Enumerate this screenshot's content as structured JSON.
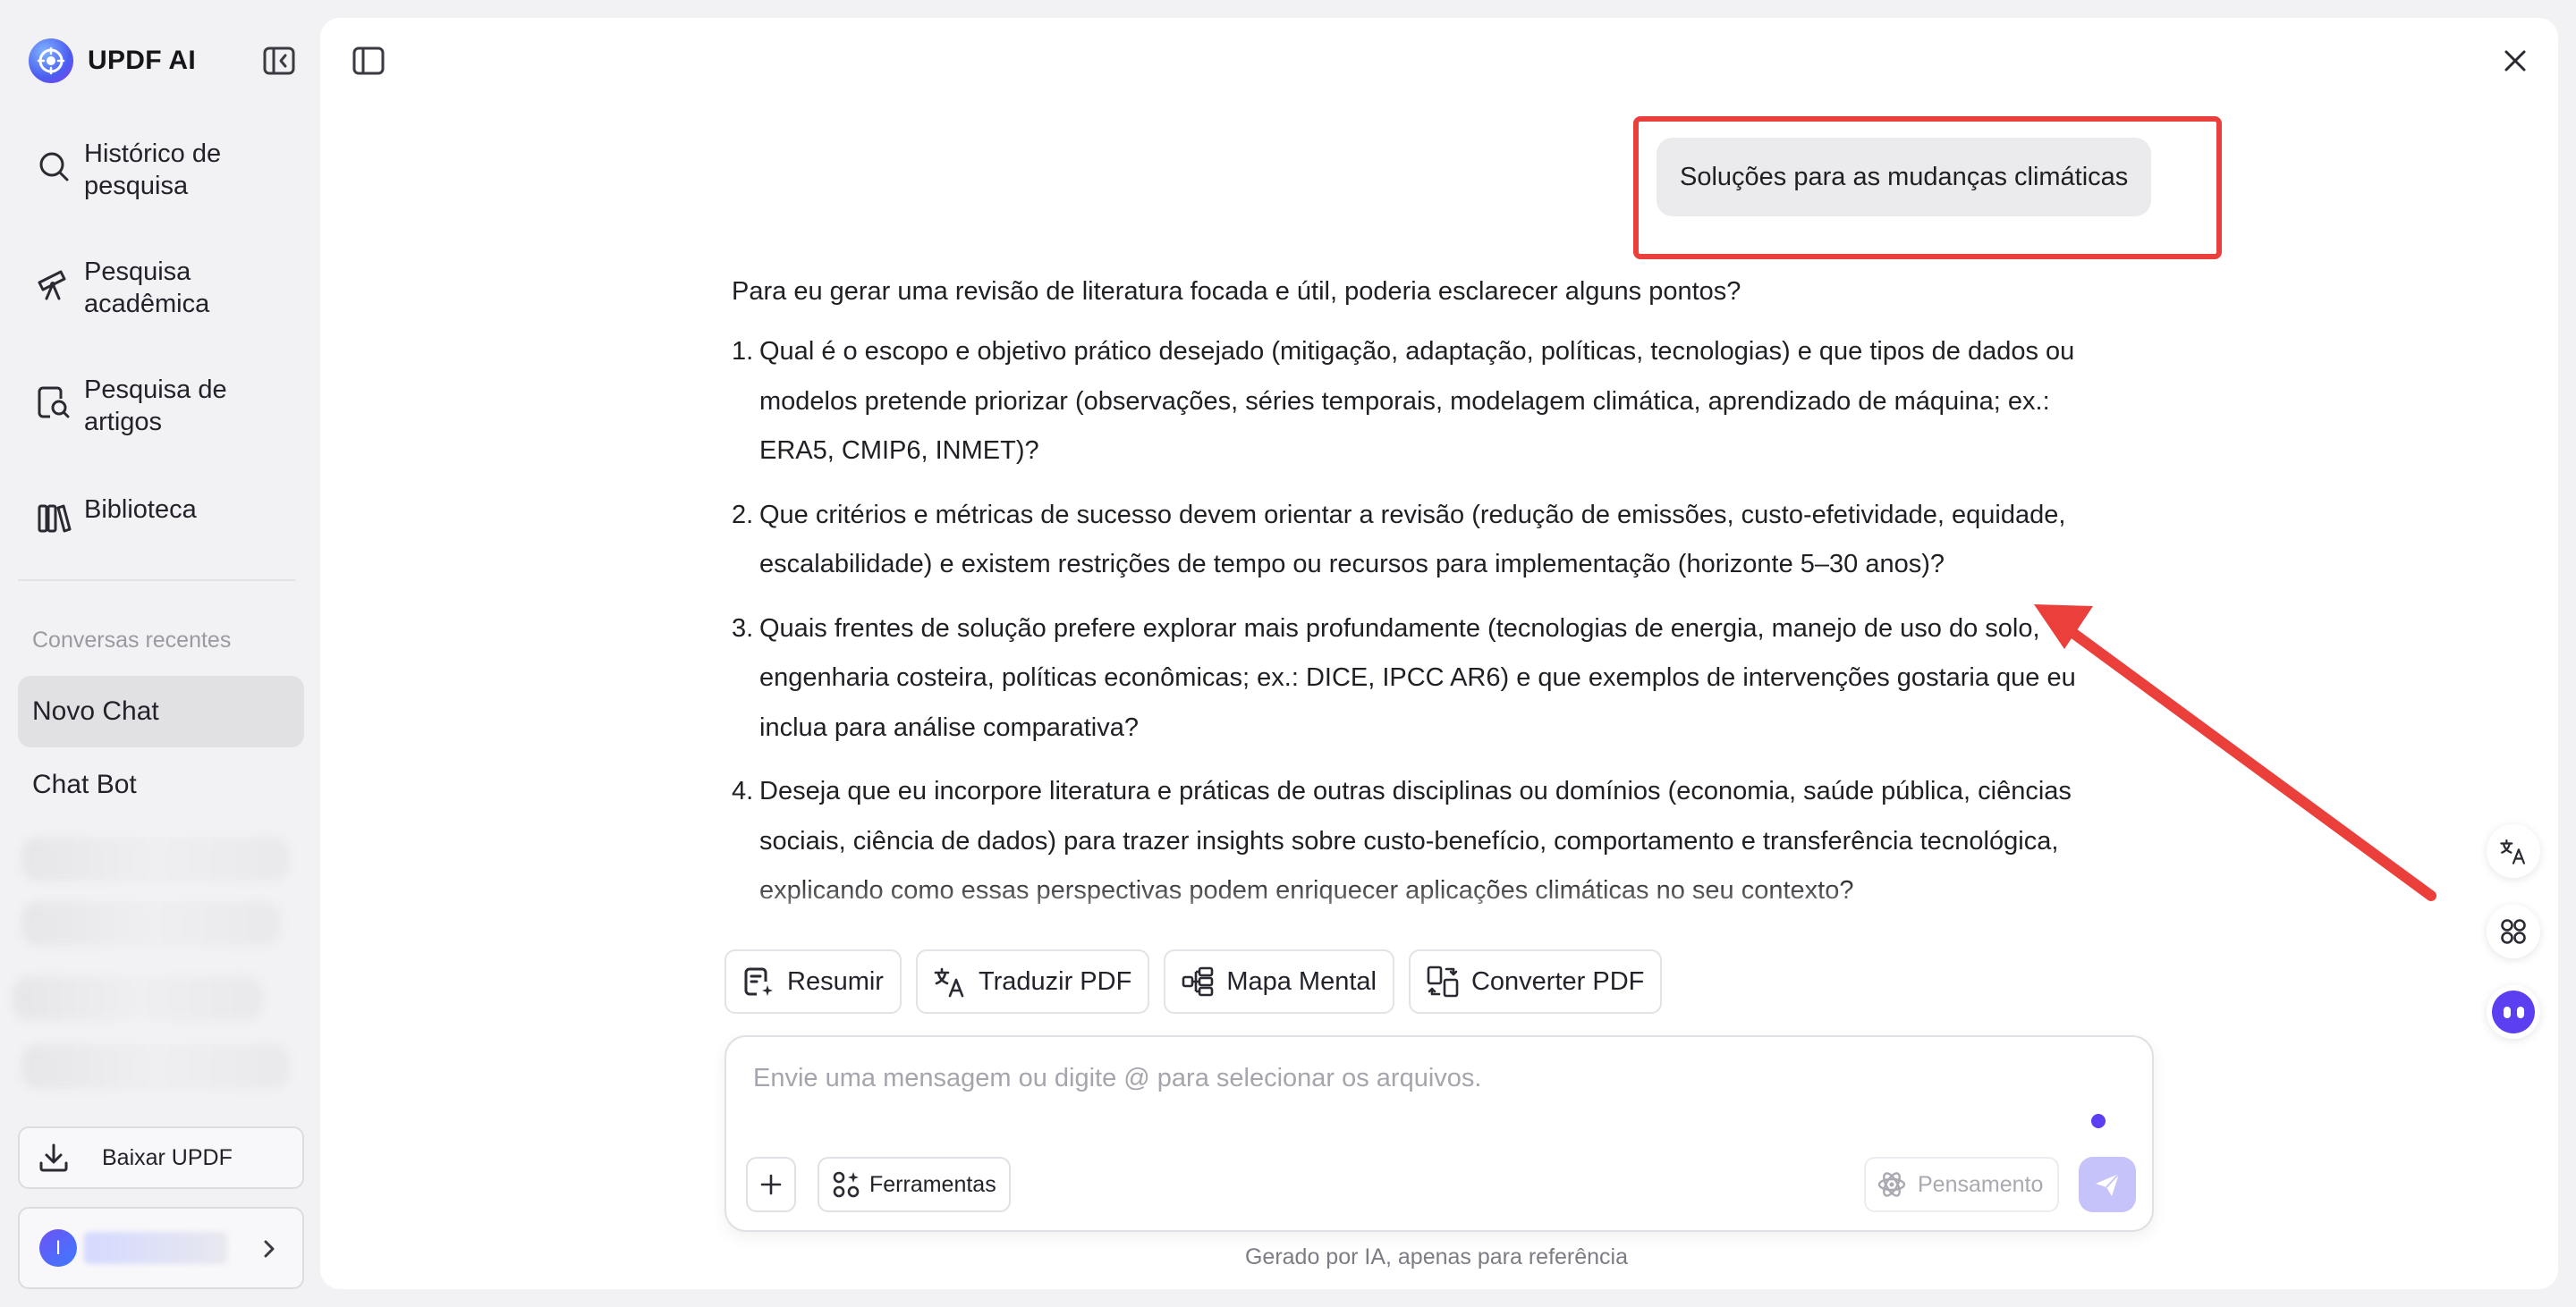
{
  "app": {
    "name": "UPDF AI"
  },
  "sidebar": {
    "nav": [
      {
        "label": "Histórico de pesquisa",
        "icon": "search-icon"
      },
      {
        "label": "Pesquisa acadêmica",
        "icon": "telescope-icon"
      },
      {
        "label": "Pesquisa de artigos",
        "icon": "document-search-icon"
      },
      {
        "label": "Biblioteca",
        "icon": "library-icon"
      }
    ],
    "recent_title": "Conversas recentes",
    "chats": [
      {
        "label": "Novo Chat",
        "active": true
      },
      {
        "label": "Chat Bot",
        "active": false
      }
    ],
    "download_label": "Baixar UPDF",
    "profile_initial": "I"
  },
  "chat": {
    "user_message": "Soluções para as mudanças climáticas",
    "assistant_intro": "Para eu gerar uma revisão de literatura focada e útil, poderia esclarecer alguns pontos?",
    "assistant_points": [
      {
        "num": "1.",
        "text": "Qual é o escopo e objetivo prático desejado (mitigação, adaptação, políticas, tecnologias) e que tipos de dados ou modelos pretende priorizar (observações, séries temporais, modelagem climática, aprendizado de máquina; ex.: ERA5, CMIP6, INMET)?"
      },
      {
        "num": "2.",
        "text": "Que critérios e métricas de sucesso devem orientar a revisão (redução de emissões, custo-efetividade, equidade, escalabilidade) e existem restrições de tempo ou recursos para implementação (horizonte 5–30 anos)?"
      },
      {
        "num": "3.",
        "text": "Quais frentes de solução prefere explorar mais profundamente (tecnologias de energia, manejo de uso do solo, engenharia costeira, políticas econômicas; ex.: DICE, IPCC AR6) e que exemplos de intervenções gostaria que eu inclua para análise comparativa?"
      },
      {
        "num": "4.",
        "text": "Deseja que eu incorpore literatura e práticas de outras disciplinas ou domínios (economia, saúde pública, ciências sociais, ciência de dados) para trazer insights sobre custo-benefício, comportamento e transferência tecnológica, explicando como essas perspectivas podem enriquecer aplicações climáticas no seu contexto?"
      }
    ]
  },
  "quick_actions": [
    {
      "label": "Resumir",
      "icon": "summarize-icon"
    },
    {
      "label": "Traduzir PDF",
      "icon": "translate-icon"
    },
    {
      "label": "Mapa Mental",
      "icon": "mindmap-icon"
    },
    {
      "label": "Converter PDF",
      "icon": "convert-icon"
    }
  ],
  "composer": {
    "placeholder": "Envie uma mensagem ou digite @ para selecionar os arquivos.",
    "tools_label": "Ferramentas",
    "thinking_label": "Pensamento"
  },
  "footer": {
    "disclaimer": "Gerado por IA, apenas para referência"
  },
  "colors": {
    "accent": "#5b3ff0",
    "annotation_red": "#ea3f3a",
    "send_disabled": "#c6c3fb"
  }
}
